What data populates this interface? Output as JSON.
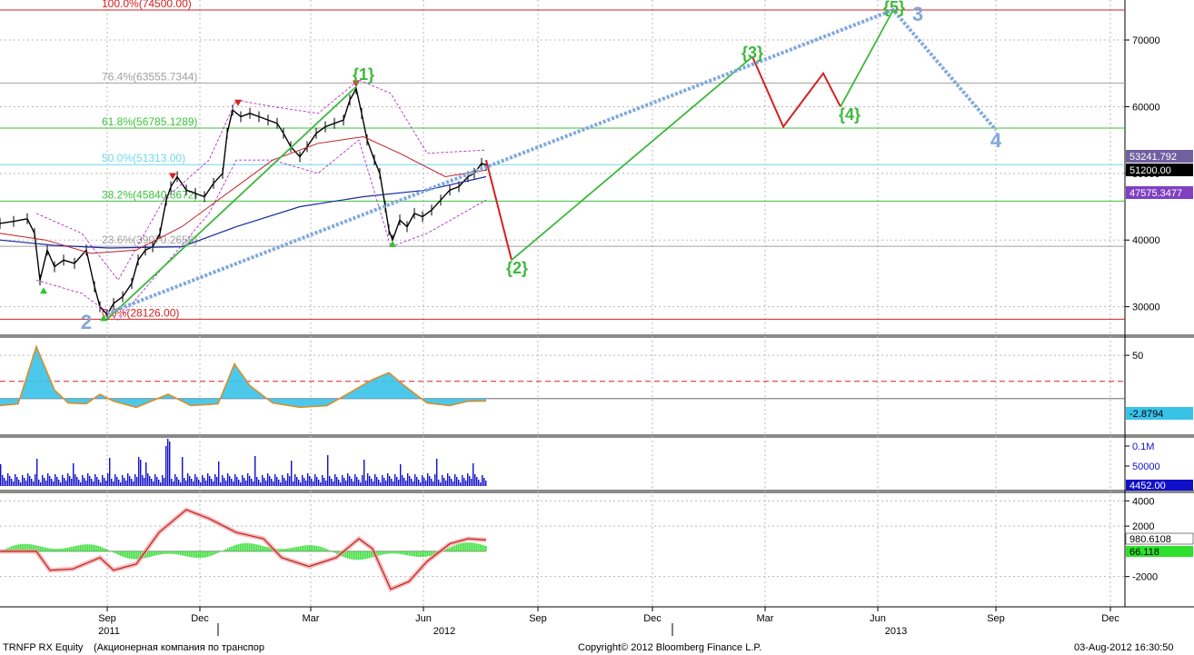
{
  "chart_data": {
    "type": "line",
    "ticker": "TRNFP RX Equity",
    "ticker_desc": "(Акционерная компания по транспор",
    "copyright": "Copyright© 2012 Bloomberg Finance L.P.",
    "timestamp": "03-Aug-2012 16:30:50",
    "x_ticks": [
      "Sep",
      "Dec",
      "Mar",
      "Jun",
      "Sep",
      "Dec",
      "Mar",
      "Jun",
      "Sep",
      "Dec"
    ],
    "x_years": [
      "2011",
      "2012",
      "2013"
    ],
    "price_panel": {
      "y_ticks": [
        "70000",
        "60000",
        "50000",
        "40000",
        "30000"
      ],
      "ylim": [
        26000,
        76000
      ],
      "last_price": "51200.00",
      "last_price_alt": "53241.792",
      "ma_label": "47575.3477",
      "fib_levels": [
        {
          "label": "100.0%(74500.00)",
          "value": 74500,
          "color": "#d42020"
        },
        {
          "label": "76.4%(63555.7344)",
          "value": 63556,
          "color": "#a0a0a0"
        },
        {
          "label": "61.8%(56785.1289)",
          "value": 56785,
          "color": "#3cc23c"
        },
        {
          "label": "50.0%(51313.00)",
          "value": 51313,
          "color": "#6fd8ee"
        },
        {
          "label": "38.2%(45840.8672)",
          "value": 45841,
          "color": "#3cc23c"
        },
        {
          "label": "23.6%(39070.2656)",
          "value": 39070,
          "color": "#a0a0a0"
        },
        {
          "label": "0.0%(28126.00)",
          "value": 28126,
          "color": "#d42020"
        }
      ],
      "wave_labels": [
        "{1}",
        "{2}",
        "{3}",
        "{4}",
        "{5}",
        "2",
        "3",
        "4"
      ]
    },
    "rsi_panel": {
      "y_ticks": [
        "50"
      ],
      "last_value": "-2.8794"
    },
    "volume_panel": {
      "y_ticks": [
        "0.1M",
        "50000"
      ],
      "last_value": "4452.00"
    },
    "macd_panel": {
      "y_ticks": [
        "4000",
        "2000",
        "-2000"
      ],
      "last_value": "980.6108",
      "hist_value": "66.118"
    }
  }
}
